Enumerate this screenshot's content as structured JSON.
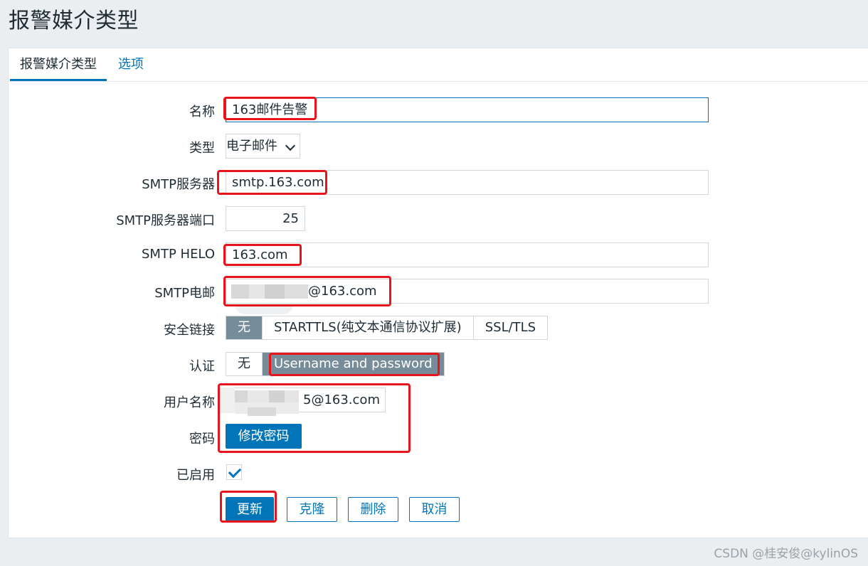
{
  "page_title": "报警媒介类型",
  "tabs": [
    {
      "label": "报警媒介类型",
      "active": true
    },
    {
      "label": "选项",
      "active": false
    }
  ],
  "form": {
    "name_label": "名称",
    "name_value": "163邮件告警",
    "type_label": "类型",
    "type_value": "电子邮件",
    "smtp_server_label": "SMTP服务器",
    "smtp_server_value": "smtp.163.com",
    "smtp_port_label": "SMTP服务器端口",
    "smtp_port_value": "25",
    "smtp_helo_label": "SMTP HELO",
    "smtp_helo_value": "163.com",
    "smtp_email_label": "SMTP电邮",
    "smtp_email_value": "@163.com",
    "security_label": "安全链接",
    "security_options": [
      "无",
      "STARTTLS(纯文本通信协议扩展)",
      "SSL/TLS"
    ],
    "security_selected": 0,
    "auth_label": "认证",
    "auth_options": [
      "无",
      "Username and password"
    ],
    "auth_selected": 1,
    "username_label": "用户名称",
    "username_value": "5@163.com",
    "password_label": "密码",
    "change_password_button": "修改密码",
    "enabled_label": "已启用",
    "enabled": true
  },
  "buttons": {
    "update": "更新",
    "clone": "克隆",
    "delete": "删除",
    "cancel": "取消"
  },
  "watermark": "CSDN @桂安俊@kylinOS",
  "colors": {
    "accent": "#0275b8",
    "selected_segment": "#768d99",
    "highlight_box": "#e8141b",
    "background": "#ebeef0"
  }
}
